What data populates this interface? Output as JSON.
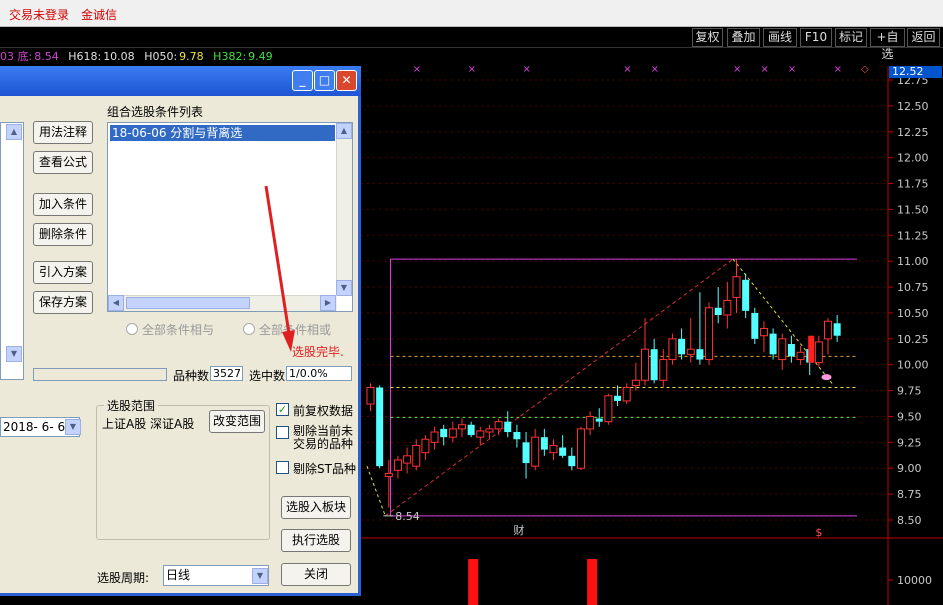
{
  "topbar": {
    "login_status": "交易未登录",
    "broker": "金诚信"
  },
  "toolbar": {
    "buttons": [
      "复权",
      "叠加",
      "画线",
      "F10",
      "标记",
      "+自选",
      "返回"
    ]
  },
  "infoline": {
    "low_label": "03 底:",
    "low_value": "8.54",
    "h618_label": "H618:",
    "h618_value": "10.08",
    "h050_label": "H050:",
    "h050_value": "9.78",
    "h382_label": "H382:",
    "h382_value": "9.49"
  },
  "dialog": {
    "buttons": {
      "usage_note": "用法注释",
      "view_formula": "查看公式",
      "add_condition": "加入条件",
      "delete_condition": "删除条件",
      "import_plan": "引入方案",
      "save_plan": "保存方案",
      "change_range": "改变范围",
      "add_to_block": "选股入板块",
      "execute": "执行选股",
      "close": "关闭"
    },
    "condition_list_label": "组合选股条件列表",
    "condition_items": [
      "18-06-06 分割与背离选"
    ],
    "radio_and": "全部条件相与",
    "radio_or": "全部条件相或",
    "done_text": "选股完毕.",
    "count_label": "品种数",
    "count_value": "3527",
    "selected_label": "选中数",
    "selected_value": "1/0.0%",
    "date_value": "2018- 6- 6",
    "range_group_label": "选股范围",
    "range_value": "上证A股  深证A股",
    "checkboxes": [
      {
        "label": "前复权数据",
        "checked": true
      },
      {
        "label": "剔除当前未交易的品种",
        "checked": false
      },
      {
        "label": "剔除ST品种",
        "checked": false
      }
    ],
    "period_label": "选股周期:",
    "period_value": "日线"
  },
  "chart_data": {
    "type": "candlestick",
    "price_axis_ticks": [
      "12.75",
      "12.50",
      "12.25",
      "12.00",
      "11.75",
      "11.50",
      "11.25",
      "11.00",
      "10.75",
      "10.50",
      "10.25",
      "10.00",
      "9.75",
      "9.50",
      "9.25",
      "9.00",
      "8.75",
      "8.50"
    ],
    "volume_axis_ticks": [
      "10000"
    ],
    "current_price": "12.52",
    "low_annotation": "8.54",
    "levels": {
      "high": 11.02,
      "h618": 10.08,
      "h050": 9.78,
      "h382": 9.49,
      "low": 8.54
    },
    "markers": {
      "fin": "财",
      "dollar": "$"
    },
    "candles": [
      [
        9.62,
        9.82,
        9.55,
        9.78
      ],
      [
        9.78,
        9.8,
        9.0,
        9.02
      ],
      [
        8.92,
        9.08,
        8.62,
        8.95
      ],
      [
        8.98,
        9.12,
        8.9,
        9.08
      ],
      [
        9.05,
        9.2,
        8.95,
        9.12
      ],
      [
        9.02,
        9.28,
        8.98,
        9.22
      ],
      [
        9.15,
        9.32,
        9.08,
        9.28
      ],
      [
        9.25,
        9.4,
        9.18,
        9.35
      ],
      [
        9.38,
        9.42,
        9.22,
        9.3
      ],
      [
        9.3,
        9.45,
        9.25,
        9.38
      ],
      [
        9.38,
        9.48,
        9.3,
        9.42
      ],
      [
        9.42,
        9.45,
        9.3,
        9.32
      ],
      [
        9.3,
        9.4,
        9.22,
        9.36
      ],
      [
        9.35,
        9.42,
        9.28,
        9.38
      ],
      [
        9.38,
        9.48,
        9.32,
        9.45
      ],
      [
        9.45,
        9.55,
        9.3,
        9.35
      ],
      [
        9.35,
        9.42,
        9.2,
        9.28
      ],
      [
        9.25,
        9.35,
        8.9,
        9.05
      ],
      [
        9.02,
        9.38,
        8.98,
        9.3
      ],
      [
        9.3,
        9.38,
        9.12,
        9.18
      ],
      [
        9.15,
        9.28,
        9.08,
        9.22
      ],
      [
        9.2,
        9.32,
        9.1,
        9.12
      ],
      [
        9.12,
        9.2,
        8.98,
        9.02
      ],
      [
        9.0,
        9.4,
        8.98,
        9.38
      ],
      [
        9.38,
        9.55,
        9.32,
        9.5
      ],
      [
        9.48,
        9.58,
        9.4,
        9.45
      ],
      [
        9.45,
        9.72,
        9.42,
        9.7
      ],
      [
        9.7,
        9.8,
        9.6,
        9.65
      ],
      [
        9.65,
        9.82,
        9.62,
        9.78
      ],
      [
        9.8,
        10.02,
        9.75,
        9.85
      ],
      [
        9.85,
        10.45,
        9.8,
        10.15
      ],
      [
        10.15,
        10.25,
        9.82,
        9.85
      ],
      [
        9.85,
        10.15,
        9.78,
        10.05
      ],
      [
        10.05,
        10.3,
        10.0,
        10.25
      ],
      [
        10.25,
        10.35,
        10.05,
        10.1
      ],
      [
        10.1,
        10.45,
        10.02,
        10.15
      ],
      [
        10.15,
        10.7,
        10.0,
        10.05
      ],
      [
        10.05,
        10.6,
        10.0,
        10.55
      ],
      [
        10.55,
        10.75,
        10.4,
        10.48
      ],
      [
        10.48,
        10.8,
        10.35,
        10.62
      ],
      [
        10.65,
        11.02,
        10.5,
        10.85
      ],
      [
        10.82,
        10.88,
        10.45,
        10.52
      ],
      [
        10.5,
        10.55,
        10.2,
        10.25
      ],
      [
        10.28,
        10.42,
        10.12,
        10.35
      ],
      [
        10.3,
        10.35,
        10.05,
        10.1
      ],
      [
        10.05,
        10.3,
        9.95,
        10.25
      ],
      [
        10.2,
        10.28,
        10.02,
        10.08
      ],
      [
        10.05,
        10.18,
        10.0,
        10.12
      ],
      [
        10.15,
        10.2,
        9.9,
        10.02
      ],
      [
        10.02,
        10.28,
        9.98,
        10.22
      ],
      [
        10.25,
        10.45,
        10.1,
        10.42
      ],
      [
        10.4,
        10.48,
        10.22,
        10.28
      ]
    ],
    "volume_spikes": [
      8,
      21
    ]
  }
}
